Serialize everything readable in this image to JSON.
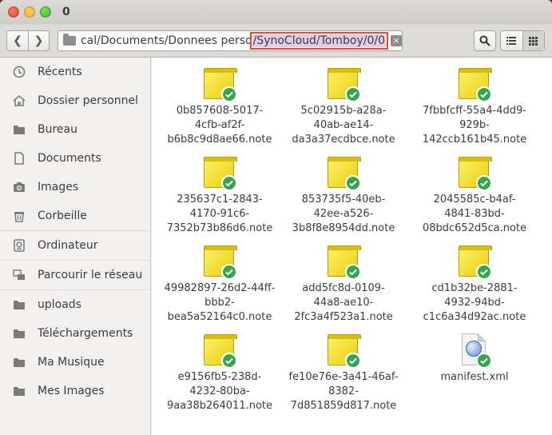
{
  "window": {
    "title": "0"
  },
  "toolbar": {
    "path_prefix": "cal/Documents/Donnees perso",
    "path_highlight": "/SynoCloud/Tomboy/0/0"
  },
  "sidebar": {
    "items": [
      {
        "label": "Récents",
        "icon": "clock-icon"
      },
      {
        "label": "Dossier personnel",
        "icon": "home-icon"
      },
      {
        "label": "Bureau",
        "icon": "folder-icon"
      },
      {
        "label": "Documents",
        "icon": "document-icon"
      },
      {
        "label": "Images",
        "icon": "camera-icon"
      },
      {
        "label": "Corbeille",
        "icon": "trash-icon"
      },
      {
        "label": "Ordinateur",
        "icon": "drive-icon"
      },
      {
        "label": "Parcourir le réseau",
        "icon": "network-icon"
      },
      {
        "label": "uploads",
        "icon": "folder-icon"
      },
      {
        "label": "Téléchargements",
        "icon": "folder-icon"
      },
      {
        "label": "Ma Musique",
        "icon": "folder-icon"
      },
      {
        "label": "Mes Images",
        "icon": "folder-icon"
      }
    ]
  },
  "files": [
    {
      "l1": "0b857608-5017-",
      "l2": "4cfb-af2f-",
      "l3": "b6b8c9d8ae66.note",
      "type": "note"
    },
    {
      "l1": "5c02915b-a28a-",
      "l2": "40ab-ae14-",
      "l3": "da3a37ecdbce.note",
      "type": "note"
    },
    {
      "l1": "7fbbfcff-55a4-4dd9-",
      "l2": "929b-",
      "l3": "142ccb161b45.note",
      "type": "note"
    },
    {
      "l1": "235637c1-2843-",
      "l2": "4170-91c6-",
      "l3": "7352b73b86d6.note",
      "type": "note"
    },
    {
      "l1": "853735f5-40eb-",
      "l2": "42ee-a526-",
      "l3": "3b8f8e8954dd.note",
      "type": "note"
    },
    {
      "l1": "2045585c-b4af-",
      "l2": "4841-83bd-",
      "l3": "08bdc652d5ca.note",
      "type": "note"
    },
    {
      "l1": "49982897-26d2-44ff-",
      "l2": "bbb2-",
      "l3": "bea5a52164c0.note",
      "type": "note"
    },
    {
      "l1": "add5fc8d-0109-",
      "l2": "44a8-ae10-",
      "l3": "2fc3a4f523a1.note",
      "type": "note"
    },
    {
      "l1": "cd1b32be-2881-",
      "l2": "4932-94bd-",
      "l3": "c1c6a34d92ac.note",
      "type": "note"
    },
    {
      "l1": "e9156fb5-238d-",
      "l2": "4232-80ba-",
      "l3": "9aa38b264011.note",
      "type": "note"
    },
    {
      "l1": "fe10e76e-3a41-46af-",
      "l2": "8382-",
      "l3": "7d851859d817.note",
      "type": "note"
    },
    {
      "l1": "manifest.xml",
      "l2": "",
      "l3": "",
      "type": "xml"
    }
  ],
  "colors": {
    "accent_highlight": "#e6cde6",
    "highlight_border": "#e2493a",
    "sync_check": "#35a64f",
    "note_yellow": "#f3dd2a"
  }
}
